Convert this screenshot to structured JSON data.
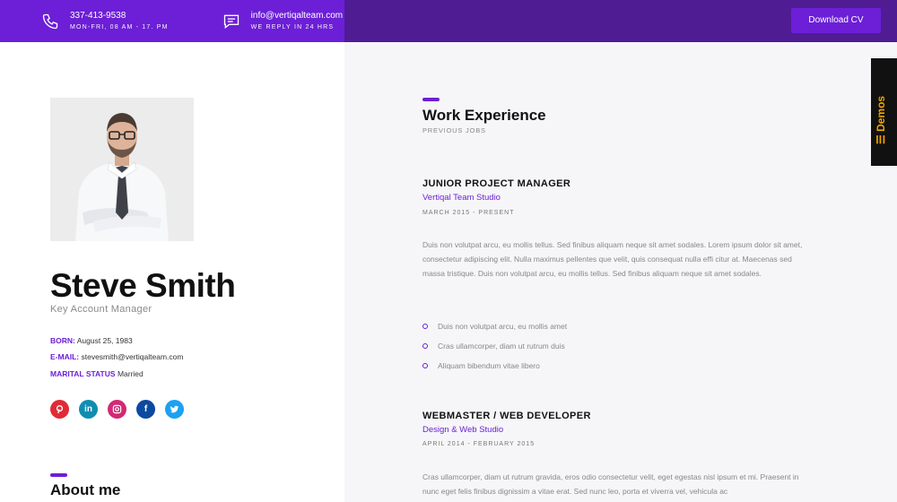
{
  "topbar": {
    "phone": {
      "number": "337-413-9538",
      "hours": "MON-FRI, 08 AM - 17. PM"
    },
    "email": {
      "address": "info@vertiqalteam.com",
      "note": "WE REPLY IN 24 HRS"
    },
    "download_label": "Download CV"
  },
  "profile": {
    "name": "Steve Smith",
    "role": "Key Account Manager",
    "born_label": "BORN:",
    "born_value": "August 25, 1983",
    "email_label": "E-MAIL:",
    "email_value": "stevesmith@vertiqalteam.com",
    "marital_label": "MARITAL STATUS",
    "marital_value": "Married",
    "socials": [
      {
        "name": "pinterest",
        "color": "#e02b37"
      },
      {
        "name": "linkedin",
        "color": "#0e8db1"
      },
      {
        "name": "instagram",
        "color": "#d12a74"
      },
      {
        "name": "facebook",
        "color": "#0c4a9f"
      },
      {
        "name": "twitter",
        "color": "#1da1f2"
      }
    ],
    "about_title": "About me"
  },
  "experience": {
    "title": "Work Experience",
    "subtitle": "PREVIOUS JOBS",
    "jobs": [
      {
        "title": "JUNIOR PROJECT MANAGER",
        "company": "Vertiqal Team Studio",
        "dates": "MARCH 2015 - PRESENT",
        "desc": "Duis non volutpat arcu, eu mollis tellus. Sed finibus aliquam neque sit amet sodales. Lorem ipsum dolor sit amet, consectetur adipiscing elit. Nulla maximus pellentes que velit, quis consequat nulla effi citur at. Maecenas sed massa tristique. Duis non volutpat arcu, eu mollis tellus. Sed finibus aliquam neque sit amet sodales.",
        "bullets": [
          "Duis non volutpat arcu, eu mollis amet",
          "Cras ullamcorper, diam ut rutrum duis",
          "Aliquam bibendum vitae libero"
        ]
      },
      {
        "title": "WEBMASTER / WEB DEVELOPER",
        "company": "Design & Web Studio",
        "dates": "APRIL 2014 - FEBRUARY 2015",
        "desc": "Cras ullamcorper, diam ut rutrum gravida, eros odio consectetur velit, eget egestas nisl ipsum et mi. Praesent in nunc eget felis finibus dignissim a vitae erat. Sed nunc leo, porta et viverra vel, vehicula ac"
      }
    ]
  },
  "demos_label": "☰ Demos",
  "colors": {
    "accent": "#6c1fd6",
    "topbar_dark": "#4f1c94",
    "demos_text": "#f0a500"
  }
}
